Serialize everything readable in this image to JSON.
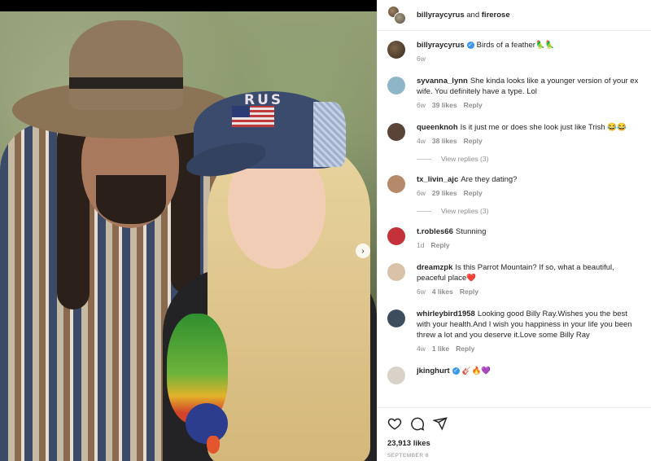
{
  "post_header": {
    "user1": "billyraycyrus",
    "joiner": "and",
    "user2": "firerose"
  },
  "caption": {
    "user": "billyraycyrus",
    "text": "Birds of a feather🦜🦜",
    "time": "6w"
  },
  "comments": [
    {
      "user": "syvanna_lynn",
      "text": "She kinda looks like a younger version of your ex wife. You definitely have a type. Lol",
      "time": "6w",
      "likes": "39 likes",
      "reply": "Reply",
      "avatar_color": "#8fb6c8"
    },
    {
      "user": "queenknoh",
      "text": "Is it just me or does she look just like Trish 😂😂",
      "time": "4w",
      "likes": "38 likes",
      "reply": "Reply",
      "avatar_color": "#5a4438"
    },
    {
      "user": "tx_livin_ajc",
      "text": "Are they dating?",
      "time": "6w",
      "likes": "29 likes",
      "reply": "Reply",
      "avatar_color": "#b58a6a"
    },
    {
      "user": "t.robles66",
      "text": "Stunning",
      "time": "1d",
      "likes": "",
      "reply": "Reply",
      "avatar_color": "#c4313a"
    },
    {
      "user": "dreamzpk",
      "text": "Is this Parrot Mountain? If so, what a beautiful, peaceful place",
      "time": "6w",
      "likes": "4 likes",
      "reply": "Reply",
      "avatar_color": "#d9c3a8"
    },
    {
      "user": "whirleybird1958",
      "text": "Looking good Billy Ray.Wishes you the best with your health.And I wish you happiness in your life you been threw a lot and you deserve it.Love some Billy Ray",
      "time": "4w",
      "likes": "1 like",
      "reply": "Reply",
      "avatar_color": "#3e4d5e"
    },
    {
      "user": "jkinghurt",
      "text": "🎸🔥💜",
      "time": "",
      "likes": "",
      "reply": "",
      "avatar_color": "#d8d2c8"
    }
  ],
  "view_replies_1": "View replies (3)",
  "view_replies_2": "View replies (3)",
  "heart_emoji": "❤️",
  "photo": {
    "cap_text": "RUS",
    "next_icon": "›"
  },
  "footer": {
    "likes": "23,913 likes",
    "date": "SEPTEMBER 8"
  }
}
